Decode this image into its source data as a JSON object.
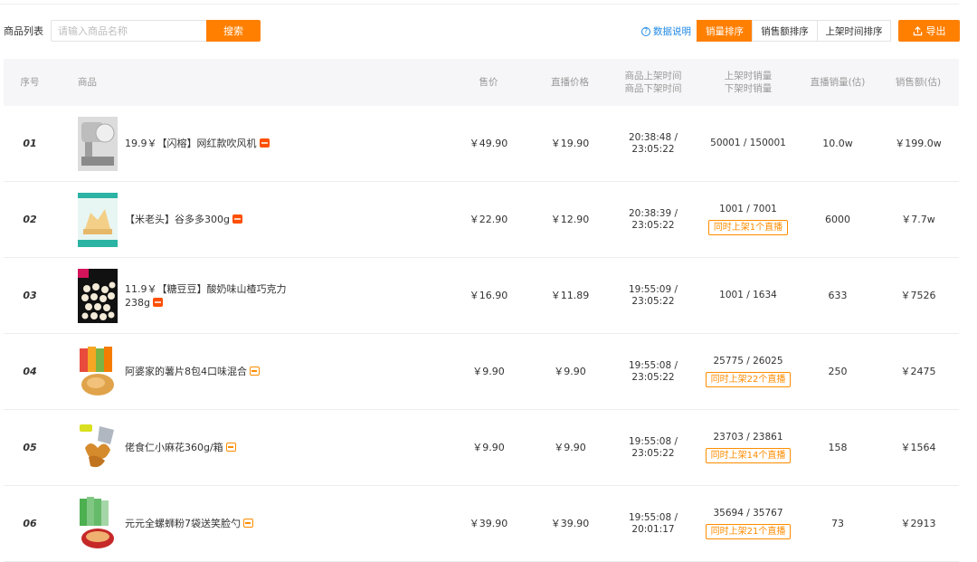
{
  "toolbar": {
    "list_title": "商品列表",
    "search_placeholder": "请输入商品名称",
    "search_value": "",
    "search_label": "搜索",
    "data_help_label": "数据说明",
    "sort_options": [
      {
        "label": "销量排序",
        "active": true
      },
      {
        "label": "销售额排序",
        "active": false
      },
      {
        "label": "上架时间排序",
        "active": false
      }
    ],
    "export_label": "导出"
  },
  "table": {
    "headers": {
      "index": "序号",
      "product": "商品",
      "price": "售价",
      "live_price": "直播价格",
      "time_line1": "商品上架时间",
      "time_line2": "商品下架时间",
      "sales_line1": "上架时销量",
      "sales_line2": "下架时销量",
      "live_sales": "直播销量(估)",
      "revenue": "销售额(估)"
    },
    "rows": [
      {
        "index": "01",
        "name": "19.9￥【闪榕】网红款吹风机",
        "tag": "tmall",
        "price": "￥49.90",
        "live_price": "￥19.90",
        "time_up": "20:38:48 /",
        "time_down": "23:05:22",
        "sales": "50001 / 150001",
        "badge": "",
        "live_sales": "10.0w",
        "revenue": "￥199.0w"
      },
      {
        "index": "02",
        "name": "【米老头】谷多多300g",
        "tag": "tmall",
        "price": "￥22.90",
        "live_price": "￥12.90",
        "time_up": "20:38:39 /",
        "time_down": "23:05:22",
        "sales": "1001 / 7001",
        "badge": "同时上架1个直播",
        "live_sales": "6000",
        "revenue": "￥7.7w"
      },
      {
        "index": "03",
        "name": "11.9￥【糖豆豆】酸奶味山楂巧克力238g",
        "tag": "tmall",
        "price": "￥16.90",
        "live_price": "￥11.89",
        "time_up": "19:55:09 /",
        "time_down": "23:05:22",
        "sales": "1001 / 1634",
        "badge": "",
        "live_sales": "633",
        "revenue": "￥7526"
      },
      {
        "index": "04",
        "name": "阿婆家的薯片8包4口味混合",
        "tag": "taobao",
        "price": "￥9.90",
        "live_price": "￥9.90",
        "time_up": "19:55:08 /",
        "time_down": "23:05:22",
        "sales": "25775 / 26025",
        "badge": "同时上架22个直播",
        "live_sales": "250",
        "revenue": "￥2475"
      },
      {
        "index": "05",
        "name": "佬食仁小麻花360g/箱",
        "tag": "taobao",
        "price": "￥9.90",
        "live_price": "￥9.90",
        "time_up": "19:55:08 /",
        "time_down": "23:05:22",
        "sales": "23703 / 23861",
        "badge": "同时上架14个直播",
        "live_sales": "158",
        "revenue": "￥1564"
      },
      {
        "index": "06",
        "name": "元元全螺蛳粉7袋送笑脸勺",
        "tag": "taobao",
        "price": "￥39.90",
        "live_price": "￥39.90",
        "time_up": "19:55:08 /",
        "time_down": "20:01:17",
        "sales": "35694 / 35767",
        "badge": "同时上架21个直播",
        "live_sales": "73",
        "revenue": "￥2913"
      }
    ]
  },
  "colors": {
    "accent": "#ff7f00",
    "link": "#1e88e5",
    "header_bg": "#f6f6f8"
  }
}
